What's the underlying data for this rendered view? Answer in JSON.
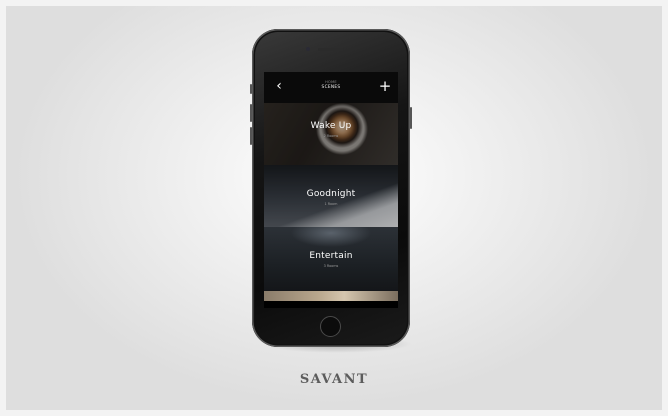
{
  "nav": {
    "back_icon": "chevron-left-icon",
    "back_glyph": "‹",
    "subtitle": "HOME",
    "title": "SCENES",
    "add_icon": "plus-icon",
    "add_glyph": "+"
  },
  "scenes": [
    {
      "name": "Wake Up",
      "rooms": "2 Rooms"
    },
    {
      "name": "Goodnight",
      "rooms": "1 Room"
    },
    {
      "name": "Entertain",
      "rooms": "3 Rooms"
    }
  ],
  "brand": {
    "name": "SAVANT"
  },
  "colors": {
    "background": "#f0f0f0",
    "phone_body": "#151515",
    "brand_text": "#5c5c5c"
  }
}
